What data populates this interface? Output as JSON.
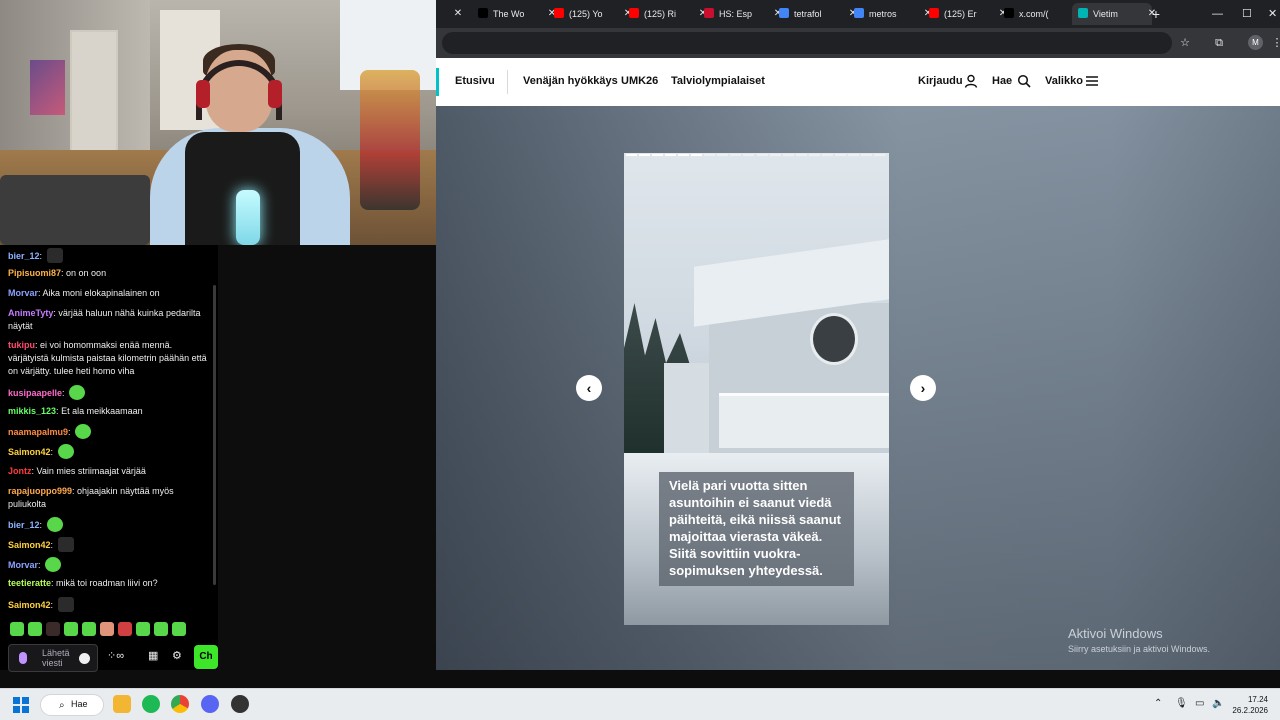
{
  "chat": {
    "messages": [
      {
        "user": "bier_12",
        "text": "",
        "color": "#8ab4ff"
      },
      {
        "user": "Pipisuomi87",
        "text": "on on oon",
        "color": "#ffb347"
      },
      {
        "user": "Morvar",
        "text": "Aika moni elokapinalainen on",
        "color": "#8aa2ff"
      },
      {
        "user": "AnimeTyty",
        "text": "värjää haluun nähä kuinka pedarilta näytät",
        "color": "#c77dff"
      },
      {
        "user": "tukipu",
        "text": "ei voi homommaksi enää mennä. värjätyistä kulmista paistaa kilometrin päähän että on värjätty. tulee heti homo viha",
        "color": "#ff4d6d"
      },
      {
        "user": "kusipaapelle",
        "text": "",
        "color": "#ff6bcb"
      },
      {
        "user": "mikkis_123",
        "text": "Et ala meikkaamaan",
        "color": "#66ff66"
      },
      {
        "user": "naamapalmu9",
        "text": "",
        "color": "#ff8c42"
      },
      {
        "user": "Saimon42",
        "text": "",
        "color": "#ffd23f"
      },
      {
        "user": "Jontz",
        "text": "Vain mies striimaajat värjää",
        "color": "#ff3b3b"
      },
      {
        "user": "rapajuoppo999",
        "text": "ohjaajakin näyttää myös puliukolta",
        "color": "#ffa94d"
      },
      {
        "user": "bier_12",
        "text": "",
        "color": "#8ab4ff"
      },
      {
        "user": "Saimon42",
        "text": "",
        "color": "#ffd23f"
      },
      {
        "user": "Morvar",
        "text": "",
        "color": "#8aa2ff"
      },
      {
        "user": "teetieratte",
        "text": "mikä toi roadman liivi on?",
        "color": "#b6ff5c"
      },
      {
        "user": "Saimon42",
        "text": "",
        "color": "#ffd23f"
      }
    ],
    "input_placeholder": "Lähetä viesti",
    "send_label": "Ch"
  },
  "browser": {
    "tabs": [
      {
        "label": "The Wo",
        "fav": "x-icon"
      },
      {
        "label": "(125) Yo",
        "fav": "youtube-icon"
      },
      {
        "label": "(125) Ri",
        "fav": "youtube-icon"
      },
      {
        "label": "HS: Esp",
        "fav": "hs-icon"
      },
      {
        "label": "tetrafol",
        "fav": "google-icon"
      },
      {
        "label": "metros",
        "fav": "google-icon"
      },
      {
        "label": "(125) Er",
        "fav": "youtube-icon"
      },
      {
        "label": "x.com/(",
        "fav": "x-icon"
      },
      {
        "label": "Vietim",
        "fav": "yle-icon"
      }
    ],
    "profile_initial": "M"
  },
  "site": {
    "nav": {
      "home": "Etusivu",
      "links": [
        "Venäjän hyökkäys",
        "UMK26",
        "Talviolympialaiset"
      ],
      "login": "Kirjaudu",
      "search": "Hae",
      "menu": "Valikko"
    },
    "story": {
      "caption": "Vielä pari vuotta sitten asuntoihin ei saanut viedä päihteitä, eikä niissä saanut majoittaa vierasta väkeä. Siitä sovittiin vuokra-sopimuksen yhteydessä.",
      "progress_segments": 20,
      "progress_done": 6
    },
    "watermark": {
      "title": "Aktivoi Windows",
      "subtitle": "Siirry asetuksiin ja aktivoi Windows."
    }
  },
  "taskbar": {
    "search_label": "Hae",
    "time": "17.24",
    "date": "26.2.2026"
  }
}
